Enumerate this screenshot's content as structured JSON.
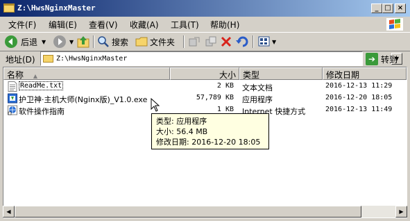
{
  "window": {
    "title": "Z:\\HwsNginxMaster",
    "minimize_label": "_",
    "maximize_label": "□",
    "close_label": "×"
  },
  "menu": {
    "file": "文件(F)",
    "edit": "编辑(E)",
    "view": "查看(V)",
    "favorites": "收藏(A)",
    "tools": "工具(T)",
    "help": "帮助(H)"
  },
  "toolbar": {
    "back_label": "后退",
    "search_label": "搜索",
    "folders_label": "文件夹"
  },
  "address": {
    "label": "地址(D)",
    "value": "Z:\\HwsNginxMaster",
    "go_label": "转到"
  },
  "columns": {
    "name": "名称",
    "size": "大小",
    "type": "类型",
    "modified": "修改日期"
  },
  "files": [
    {
      "name": "ReadMe.txt",
      "size": "2 KB",
      "type": "文本文档",
      "modified": "2016-12-13 11:29"
    },
    {
      "name": "护卫神·主机大师(Nginx版)_V1.0.exe",
      "size": "57,789 KB",
      "type": "应用程序",
      "modified": "2016-12-20 18:05"
    },
    {
      "name": "软件操作指南",
      "size": "1 KB",
      "type": "Internet 快捷方式",
      "modified": "2016-12-13 11:49"
    }
  ],
  "tooltip": {
    "line1": "类型: 应用程序",
    "line2": "大小: 56.4 MB",
    "line3": "修改日期: 2016-12-20 18:05"
  },
  "colors": {
    "title_start": "#0a246a",
    "title_end": "#a6caf0",
    "chrome": "#d4d0c8",
    "tooltip_bg": "#ffffe1"
  }
}
